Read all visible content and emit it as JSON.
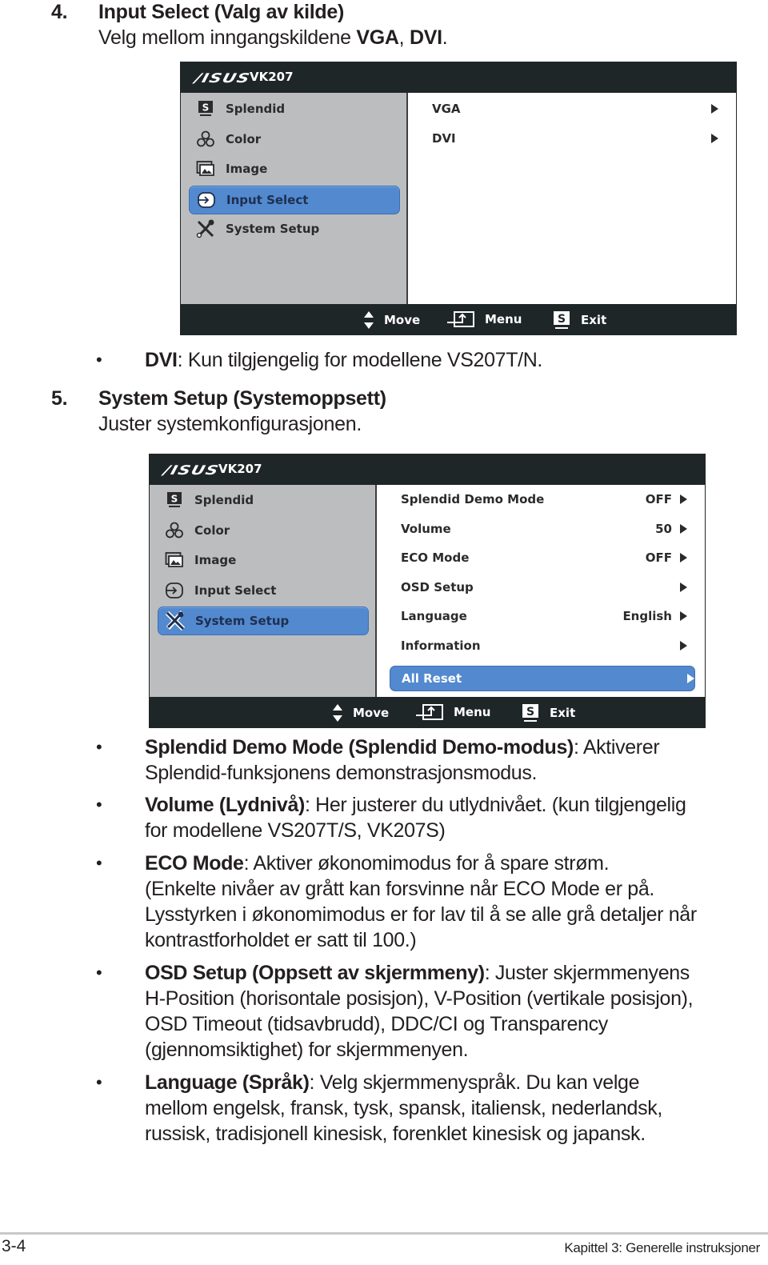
{
  "section4": {
    "number": "4.",
    "title": "Input Select (Valg av kilde)",
    "desc_prefix": "Velg mellom inngangskildene ",
    "desc_bold1": "VGA",
    "desc_sep": ", ",
    "desc_bold2": "DVI",
    "desc_suffix": "."
  },
  "osd1": {
    "brand": "/ISUS",
    "model": "VK207",
    "menu": [
      {
        "label": "Splendid",
        "icon": "splendid-s-icon"
      },
      {
        "label": "Color",
        "icon": "rgb-color-icon"
      },
      {
        "label": "Image",
        "icon": "image-icon"
      },
      {
        "label": "Input Select",
        "icon": "input-select-icon",
        "selected": true
      },
      {
        "label": "System Setup",
        "icon": "wrench-screwdriver-icon"
      }
    ],
    "options": [
      {
        "label": "VGA",
        "value": ""
      },
      {
        "label": "DVI",
        "value": ""
      }
    ],
    "footer": {
      "move": "Move",
      "menu": "Menu",
      "exit": "Exit",
      "exit_key": "S"
    }
  },
  "bullet_dvi": {
    "bold": "DVI",
    "text": ": Kun tilgjengelig for modellene VS207T/N."
  },
  "section5": {
    "number": "5.",
    "title": "System Setup (Systemoppsett)",
    "desc": "Juster systemkonfigurasjonen."
  },
  "osd2": {
    "brand": "/ISUS",
    "model": "VK207",
    "menu": [
      {
        "label": "Splendid",
        "icon": "splendid-s-icon"
      },
      {
        "label": "Color",
        "icon": "rgb-color-icon"
      },
      {
        "label": "Image",
        "icon": "image-icon"
      },
      {
        "label": "Input Select",
        "icon": "input-select-icon"
      },
      {
        "label": "System Setup",
        "icon": "wrench-screwdriver-icon",
        "selected": true
      }
    ],
    "options": [
      {
        "label": "Splendid Demo Mode",
        "value": "OFF"
      },
      {
        "label": "Volume",
        "value": "50"
      },
      {
        "label": "ECO Mode",
        "value": "OFF"
      },
      {
        "label": "OSD Setup",
        "value": ""
      },
      {
        "label": "Language",
        "value": "English"
      },
      {
        "label": "Information",
        "value": ""
      },
      {
        "label": "All Reset",
        "value": "",
        "selected": true
      }
    ],
    "footer": {
      "move": "Move",
      "menu": "Menu",
      "exit": "Exit",
      "exit_key": "S"
    }
  },
  "bullets": [
    {
      "lines": [
        {
          "bold": "Splendid Demo Mode (Splendid Demo-modus)",
          "text": ": Aktiverer"
        },
        {
          "bold": "",
          "text": "Splendid-funksjonens demonstrasjonsmodus."
        }
      ]
    },
    {
      "lines": [
        {
          "bold": "Volume (Lydnivå)",
          "text": ": Her justerer du utlydnivået. (kun tilgjengelig"
        },
        {
          "bold": "",
          "text": "for modellene VS207T/S, VK207S)"
        }
      ]
    },
    {
      "lines": [
        {
          "bold": "ECO Mode",
          "text": ": Aktiver økonomimodus for å spare strøm."
        },
        {
          "bold": "",
          "text": "(Enkelte nivåer av grått kan forsvinne når ECO Mode er på."
        },
        {
          "bold": "",
          "text": "Lysstyrken i økonomimodus er for lav til å se alle grå detaljer når"
        },
        {
          "bold": "",
          "text": "kontrastforholdet er satt til 100.)"
        }
      ]
    },
    {
      "lines": [
        {
          "bold": "OSD Setup (Oppsett av skjermmeny)",
          "text": ": Juster skjermmenyens"
        },
        {
          "bold": "",
          "text": "H-Position (horisontale posisjon), V-Position (vertikale posisjon),"
        },
        {
          "bold": "",
          "text": "OSD Timeout (tidsavbrudd), DDC/CI og Transparency"
        },
        {
          "bold": "",
          "text": "(gjennomsiktighet) for skjermmenyen."
        }
      ]
    },
    {
      "lines": [
        {
          "bold": "Language (Språk)",
          "text": ": Velg skjermmenyspråk. Du kan velge"
        },
        {
          "bold": "",
          "text": "mellom engelsk, fransk, tysk, spansk, italiensk, nederlandsk,"
        },
        {
          "bold": "",
          "text": "russisk, tradisjonell kinesisk, forenklet kinesisk og japansk."
        }
      ]
    }
  ],
  "page_footer": {
    "page_number": "3-4",
    "chapter": "Kapittel 3: Generelle instruksjoner"
  },
  "colors": {
    "osd_dark": "#1f2628",
    "osd_panel_gray": "#bcbdbf",
    "highlight_blue": "#5289cf"
  }
}
